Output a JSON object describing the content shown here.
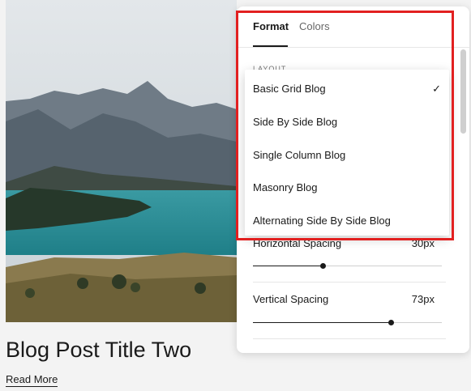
{
  "post": {
    "title": "Blog Post Title Two",
    "read_more": "Read More"
  },
  "panel": {
    "tabs": [
      {
        "label": "Format",
        "active": true
      },
      {
        "label": "Colors",
        "active": false
      }
    ],
    "section_label": "LAYOUT",
    "horizontal_spacing": {
      "label": "Horizontal Spacing",
      "value": "30px",
      "level": 0.37
    },
    "vertical_spacing": {
      "label": "Vertical Spacing",
      "value": "73px",
      "level": 0.73
    }
  },
  "layout_dropdown": {
    "options": [
      {
        "label": "Basic Grid Blog",
        "selected": true
      },
      {
        "label": "Side By Side Blog",
        "selected": false
      },
      {
        "label": "Single Column Blog",
        "selected": false
      },
      {
        "label": "Masonry Blog",
        "selected": false
      },
      {
        "label": "Alternating Side By Side Blog",
        "selected": false
      }
    ],
    "check_icon": "check-icon"
  },
  "colors": {
    "highlight": "#e22020",
    "text": "#1a1a1a",
    "water": "#2f8f97"
  }
}
